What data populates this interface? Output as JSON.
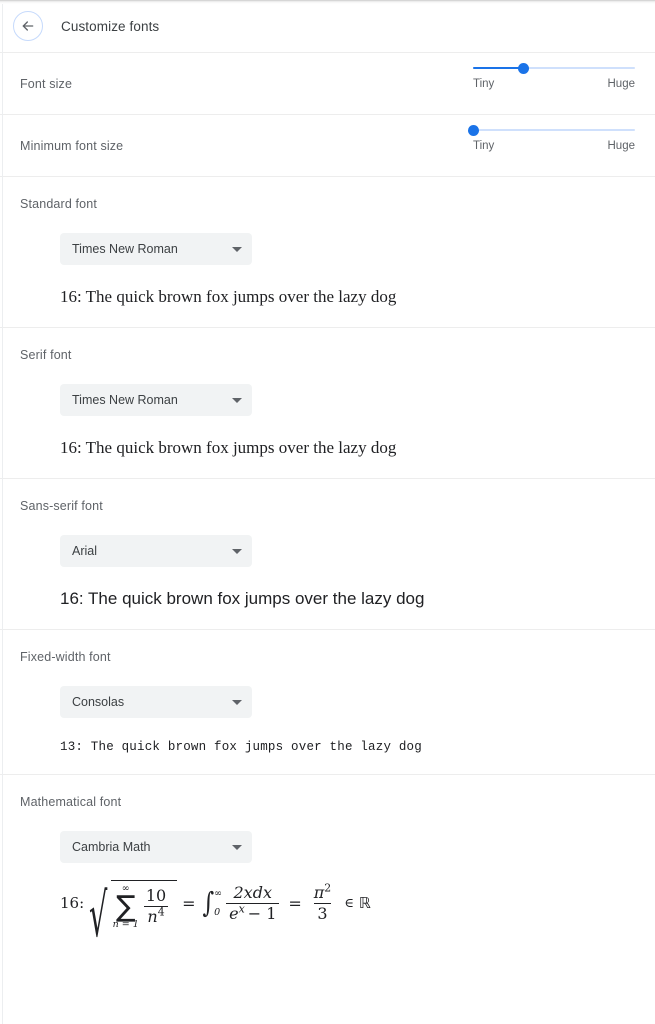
{
  "header": {
    "back_icon": "arrow-left-icon",
    "title": "Customize fonts"
  },
  "sliders": [
    {
      "label": "Font size",
      "min_label": "Tiny",
      "max_label": "Huge",
      "value_percent": 31
    },
    {
      "label": "Minimum font size",
      "min_label": "Tiny",
      "max_label": "Huge",
      "value_percent": 0
    }
  ],
  "font_sections": [
    {
      "label": "Standard font",
      "selected": "Times New Roman",
      "caret_icon": "chevron-down-icon",
      "preview": "16: The quick brown fox jumps over the lazy dog",
      "size": "16"
    },
    {
      "label": "Serif font",
      "selected": "Times New Roman",
      "caret_icon": "chevron-down-icon",
      "preview": "16: The quick brown fox jumps over the lazy dog",
      "size": "16"
    },
    {
      "label": "Sans-serif font",
      "selected": "Arial",
      "caret_icon": "chevron-down-icon",
      "preview": "16: The quick brown fox jumps over the lazy dog",
      "size": "16"
    },
    {
      "label": "Fixed-width font",
      "selected": "Consolas",
      "caret_icon": "chevron-down-icon",
      "preview": "13: The quick brown fox jumps over the lazy dog",
      "size": "13"
    }
  ],
  "math_section": {
    "label": "Mathematical font",
    "selected": "Cambria Math",
    "caret_icon": "chevron-down-icon",
    "size_prefix": "16:",
    "formula_plain": "16: √(Σ n=1..∞ 10/n⁴) = ∫₀^∞ 2xdx/(eˣ − 1) = π²/3 ∈ ℝ",
    "formula_parts": {
      "sum_upper": "∞",
      "sum_glyph": "∑",
      "sum_lower": "n = 1",
      "sum_numerator": "10",
      "sum_denominator_base": "n",
      "sum_denominator_exp": "4",
      "equals_1": "=",
      "integral_glyph": "∫",
      "integral_upper": "∞",
      "integral_lower": "0",
      "int_numerator": "2xdx",
      "int_den_base": "e",
      "int_den_exp": "x",
      "int_den_rest": "− 1",
      "equals_2": "=",
      "pi_symbol": "π",
      "pi_exp": "2",
      "pi_denominator": "3",
      "member_symbol": "∈",
      "reals_symbol": "ℝ"
    }
  },
  "colors": {
    "accent": "#1a73e8",
    "track_inactive": "#cfe0fc",
    "select_bg": "#f1f3f4",
    "label_text": "#5f6368",
    "primary_text": "#3c4043",
    "divider": "#ededed"
  }
}
